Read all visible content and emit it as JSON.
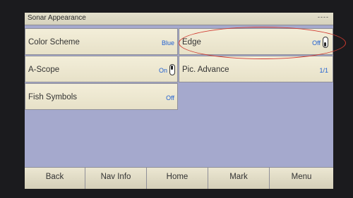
{
  "window": {
    "title": "Sonar Appearance",
    "status": "----"
  },
  "settings": {
    "color_scheme": {
      "label": "Color Scheme",
      "value": "Blue"
    },
    "edge": {
      "label": "Edge",
      "value": "Off",
      "toggle_state": "off"
    },
    "a_scope": {
      "label": "A-Scope",
      "value": "On",
      "toggle_state": "on"
    },
    "pic_advance": {
      "label": "Pic. Advance",
      "value": "1/1"
    },
    "fish_symbols": {
      "label": "Fish Symbols",
      "value": "Off"
    }
  },
  "nav": {
    "back": "Back",
    "nav_info": "Nav Info",
    "home": "Home",
    "mark": "Mark",
    "menu": "Menu"
  },
  "colors": {
    "accent_value": "#1f5fd1",
    "highlight_circle": "#d03a30",
    "screen_background": "#a5a9cd",
    "tile_background": "#f3eed9"
  }
}
